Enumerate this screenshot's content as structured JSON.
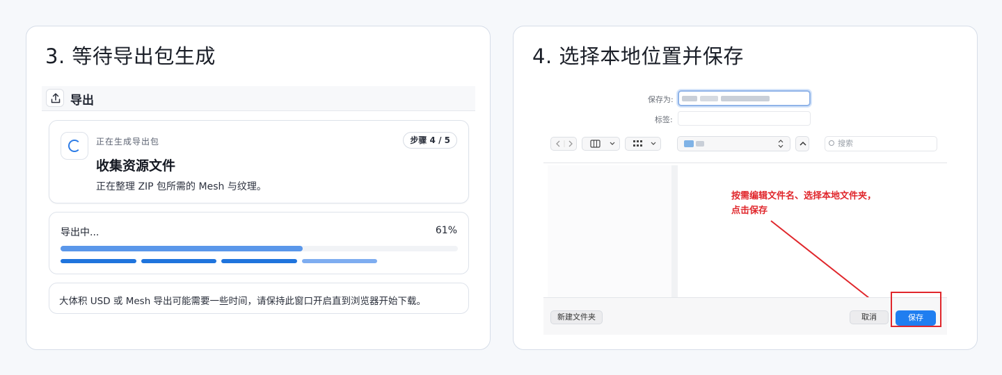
{
  "panel3": {
    "title": "3. 等待导出包生成",
    "header": {
      "label": "导出",
      "icon": "upload-icon"
    },
    "status": {
      "icon": "spinner-icon",
      "subtitle": "正在生成导出包",
      "step_badge": "步骤 4 / 5",
      "title": "收集资源文件",
      "description": "正在整理 ZIP 包所需的 Mesh 与纹理。"
    },
    "progress": {
      "label": "导出中...",
      "percent_text": "61%",
      "fraction": 0.61,
      "step_states": [
        "done",
        "done",
        "done",
        "active",
        "pending"
      ],
      "colors": {
        "fill": "#5a97ea",
        "done": "#1f74dd",
        "active": "#7eadf0"
      }
    },
    "note": "大体积 USD 或 Mesh 导出可能需要一些时间，请保持此窗口开启直到浏览器开始下载。"
  },
  "panel4": {
    "title": "4. 选择本地位置并保存",
    "dialog": {
      "save_as_label": "保存为:",
      "tags_label": "标签:",
      "search_placeholder": "搜索",
      "annotation_line1": "按需编辑文件名、选择本地文件夹，",
      "annotation_line2": "点击保存",
      "new_folder_button": "新建文件夹",
      "cancel_button": "取消",
      "save_button": "保存",
      "accent_color": "#e0262b"
    }
  }
}
